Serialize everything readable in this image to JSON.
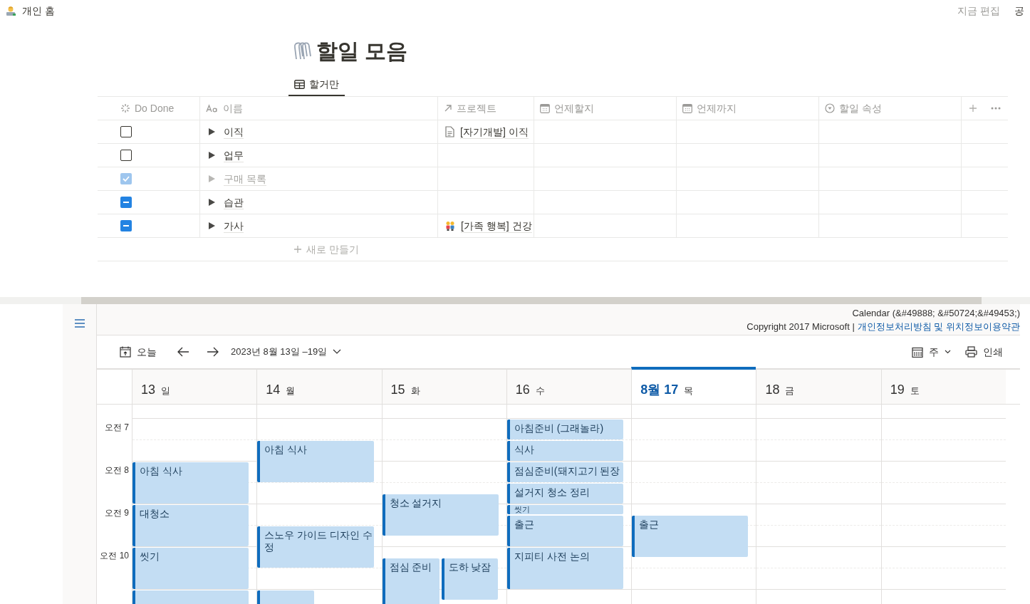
{
  "topbar": {
    "breadcrumb": "개인 홈",
    "actions": [
      "지금 편집",
      "공"
    ]
  },
  "page": {
    "title": "할일 모음"
  },
  "views": [
    {
      "label": "할거만",
      "selected": true
    }
  ],
  "table": {
    "columns": [
      {
        "label": "Do Done",
        "kind": "status"
      },
      {
        "label": "이름",
        "kind": "title"
      },
      {
        "label": "프로젝트",
        "kind": "relation"
      },
      {
        "label": "언제할지",
        "kind": "date"
      },
      {
        "label": "언제까지",
        "kind": "date"
      },
      {
        "label": "할일 속성",
        "kind": "select"
      }
    ],
    "rows": [
      {
        "checked": false,
        "indeterminate": false,
        "name": "이직",
        "project": {
          "kind": "page",
          "label": "[자기개발] 이직"
        }
      },
      {
        "checked": false,
        "indeterminate": false,
        "name": "업무"
      },
      {
        "checked": true,
        "indeterminate": false,
        "name": "구매 목록"
      },
      {
        "checked": false,
        "indeterminate": true,
        "name": "습관"
      },
      {
        "checked": false,
        "indeterminate": true,
        "name": "가사",
        "project": {
          "kind": "people",
          "label": "[가족 행복] 건강"
        }
      }
    ],
    "new_row": "새로 만들기"
  },
  "calendar": {
    "header": {
      "title": "Calendar (&#49888; &#50724;&#49453;)",
      "copyright": "Copyright 2017 Microsoft |",
      "link": "개인정보처리방침 및 위치정보이용약관"
    },
    "toolbar": {
      "today": "오늘",
      "range": "2023년 8월 13일 –19일",
      "view": "주",
      "print": "인쇄"
    },
    "hours": [
      "오전 7",
      "오전 8",
      "오전 9",
      "오전 10"
    ],
    "days": [
      {
        "date": "13",
        "weekday": "일",
        "selected": false,
        "events": [
          {
            "kind": "event",
            "title": "아침 식사"
          },
          {
            "kind": "event",
            "title": "대청소"
          },
          {
            "kind": "event",
            "title": "씻기"
          },
          {
            "kind": "event"
          }
        ]
      },
      {
        "date": "14",
        "weekday": "월",
        "selected": false,
        "events": [
          {
            "kind": "event",
            "title": "아침 식사"
          },
          {
            "kind": "event",
            "title": "스노우 가이드 디자인 수정"
          },
          {
            "kind": "event"
          }
        ]
      },
      {
        "date": "15",
        "weekday": "화",
        "selected": false,
        "events": [
          {
            "kind": "event",
            "title": "청소 설거지"
          },
          {
            "kind": "event",
            "title": "점심 준비"
          },
          {
            "kind": "event",
            "title": "도하 낮잠"
          }
        ]
      },
      {
        "date": "16",
        "weekday": "수",
        "selected": false,
        "events": [
          {
            "kind": "event",
            "title": "아침준비 (그래놀라)"
          },
          {
            "kind": "event",
            "title": "식사"
          },
          {
            "kind": "event",
            "title": "점심준비(돼지고기 된장"
          },
          {
            "kind": "event",
            "title": "설거지 청소 정리"
          },
          {
            "kind": "event",
            "title": "씻기"
          },
          {
            "kind": "event",
            "title": "출근"
          },
          {
            "kind": "event",
            "title": "지피티 사전 논의"
          }
        ]
      },
      {
        "date": "8월 17",
        "weekday": "목",
        "selected": true,
        "events": [
          {
            "kind": "event",
            "title": "출근"
          }
        ]
      },
      {
        "date": "18",
        "weekday": "금",
        "selected": false
      },
      {
        "date": "19",
        "weekday": "토",
        "selected": false
      }
    ]
  }
}
